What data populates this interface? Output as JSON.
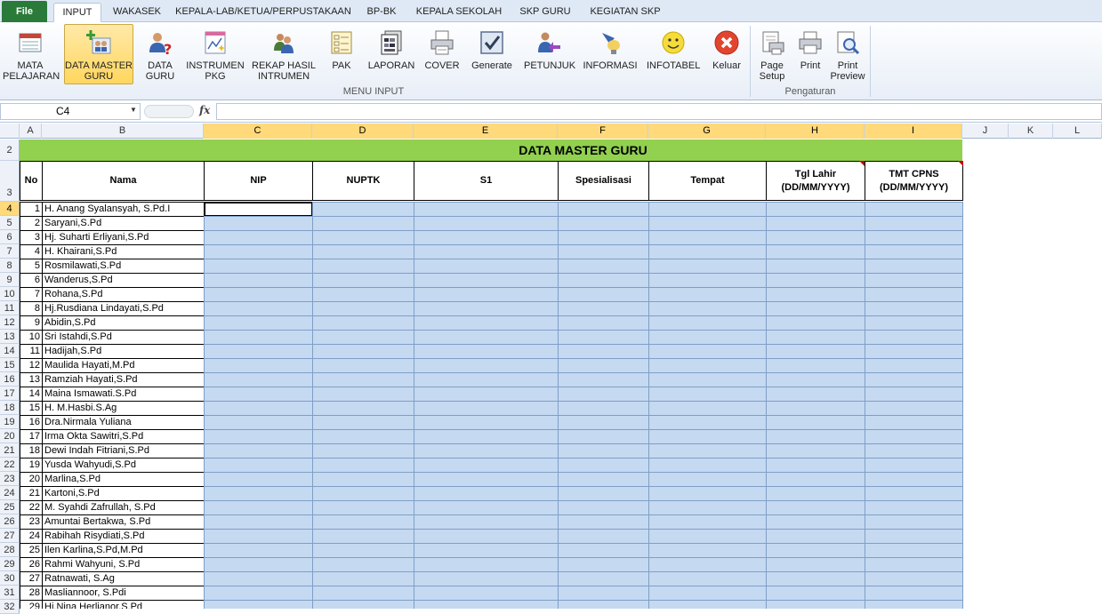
{
  "tabs": [
    "File",
    "INPUT",
    "WAKASEK",
    "KEPALA-LAB/KETUA/PERPUSTAKAAN",
    "BP-BK",
    "KEPALA SEKOLAH",
    "SKP GURU",
    "KEGIATAN SKP"
  ],
  "ribbon": {
    "buttons": [
      {
        "label1": "MATA",
        "label2": "PELAJARAN",
        "icon": "table-icon"
      },
      {
        "label1": "DATA MASTER",
        "label2": "GURU",
        "icon": "people-add-icon"
      },
      {
        "label1": "DATA",
        "label2": "GURU",
        "icon": "user-question-icon"
      },
      {
        "label1": "INSTRUMEN",
        "label2": "PKG",
        "icon": "chart-sparkle-icon"
      },
      {
        "label1": "REKAP HASIL",
        "label2": "INTRUMEN",
        "icon": "users-icon"
      },
      {
        "label1": "PAK",
        "label2": "",
        "icon": "form-icon"
      },
      {
        "label1": "LAPORAN",
        "label2": "",
        "icon": "report-icon"
      },
      {
        "label1": "COVER",
        "label2": "",
        "icon": "print-doc-icon"
      },
      {
        "label1": "Generate",
        "label2": "",
        "icon": "checkbox-icon"
      },
      {
        "label1": "PETUNJUK",
        "label2": "",
        "icon": "user-arrow-icon"
      },
      {
        "label1": "INFORMASI",
        "label2": "",
        "icon": "lamp-icon"
      },
      {
        "label1": "INFOTABEL",
        "label2": "",
        "icon": "smiley-icon"
      },
      {
        "label1": "Keluar",
        "label2": "",
        "icon": "close-icon"
      },
      {
        "label1": "Page",
        "label2": "Setup",
        "icon": "page-setup-icon"
      },
      {
        "label1": "Print",
        "label2": "",
        "icon": "printer-icon"
      },
      {
        "label1": "Print",
        "label2": "Preview",
        "icon": "preview-icon"
      }
    ],
    "group1": "MENU INPUT",
    "group2": "Pengaturan"
  },
  "namebox": "C4",
  "fx": "fx",
  "columns": [
    "A",
    "B",
    "C",
    "D",
    "E",
    "F",
    "G",
    "H",
    "I",
    "J",
    "K",
    "L"
  ],
  "sheet": {
    "title": "DATA MASTER GURU",
    "headers": {
      "no": "No",
      "nama": "Nama",
      "nip": "NIP",
      "nuptk": "NUPTK",
      "s1": "S1",
      "spesialisasi": "Spesialisasi",
      "tempat": "Tempat",
      "tgl1": "Tgl Lahir",
      "tgl2": "(DD/MM/YYYY)",
      "tmt1": "TMT CPNS",
      "tmt2": "(DD/MM/YYYY)"
    },
    "rows": [
      {
        "no": "1",
        "nama": "H. Anang Syalansyah, S.Pd.I"
      },
      {
        "no": "2",
        "nama": "Saryani,S.Pd"
      },
      {
        "no": "3",
        "nama": "Hj. Suharti Erliyani,S.Pd"
      },
      {
        "no": "4",
        "nama": "H. Khairani,S.Pd"
      },
      {
        "no": "5",
        "nama": "Rosmilawati,S.Pd"
      },
      {
        "no": "6",
        "nama": "Wanderus,S.Pd"
      },
      {
        "no": "7",
        "nama": "Rohana,S.Pd"
      },
      {
        "no": "8",
        "nama": "Hj.Rusdiana Lindayati,S.Pd"
      },
      {
        "no": "9",
        "nama": "Abidin,S.Pd"
      },
      {
        "no": "10",
        "nama": "Sri Istahdi,S.Pd"
      },
      {
        "no": "11",
        "nama": "Hadijah,S.Pd"
      },
      {
        "no": "12",
        "nama": "Maulida Hayati,M.Pd"
      },
      {
        "no": "13",
        "nama": "Ramziah Hayati,S.Pd"
      },
      {
        "no": "14",
        "nama": "Maina Ismawati.S.Pd"
      },
      {
        "no": "15",
        "nama": "H. M.Hasbi.S.Ag"
      },
      {
        "no": "16",
        "nama": "Dra.Nirmala Yuliana"
      },
      {
        "no": "17",
        "nama": "Irma Okta Sawitri,S.Pd"
      },
      {
        "no": "18",
        "nama": "Dewi Indah Fitriani,S.Pd"
      },
      {
        "no": "19",
        "nama": "Yusda Wahyudi,S.Pd"
      },
      {
        "no": "20",
        "nama": "Marlina,S.Pd"
      },
      {
        "no": "21",
        "nama": "Kartoni,S.Pd"
      },
      {
        "no": "22",
        "nama": "M. Syahdi Zafrullah, S.Pd"
      },
      {
        "no": "23",
        "nama": "Amuntai Bertakwa, S.Pd"
      },
      {
        "no": "24",
        "nama": "Rabihah Risydiati,S.Pd"
      },
      {
        "no": "25",
        "nama": "Ilen Karlina,S.Pd,M.Pd"
      },
      {
        "no": "26",
        "nama": "Rahmi Wahyuni, S.Pd"
      },
      {
        "no": "27",
        "nama": "Ratnawati, S.Ag"
      },
      {
        "no": "28",
        "nama": "Masliannoor, S.Pdi"
      },
      {
        "no": "29",
        "nama": "Hj.Nina Herlianor,S.Pd"
      }
    ],
    "rownums": [
      "2",
      "3",
      "4",
      "5",
      "6",
      "7",
      "8",
      "9",
      "10",
      "11",
      "12",
      "13",
      "14",
      "15",
      "16",
      "17",
      "18",
      "19",
      "20",
      "21",
      "22",
      "23",
      "24",
      "25",
      "26",
      "27",
      "28",
      "29",
      "30",
      "31",
      "32"
    ]
  }
}
